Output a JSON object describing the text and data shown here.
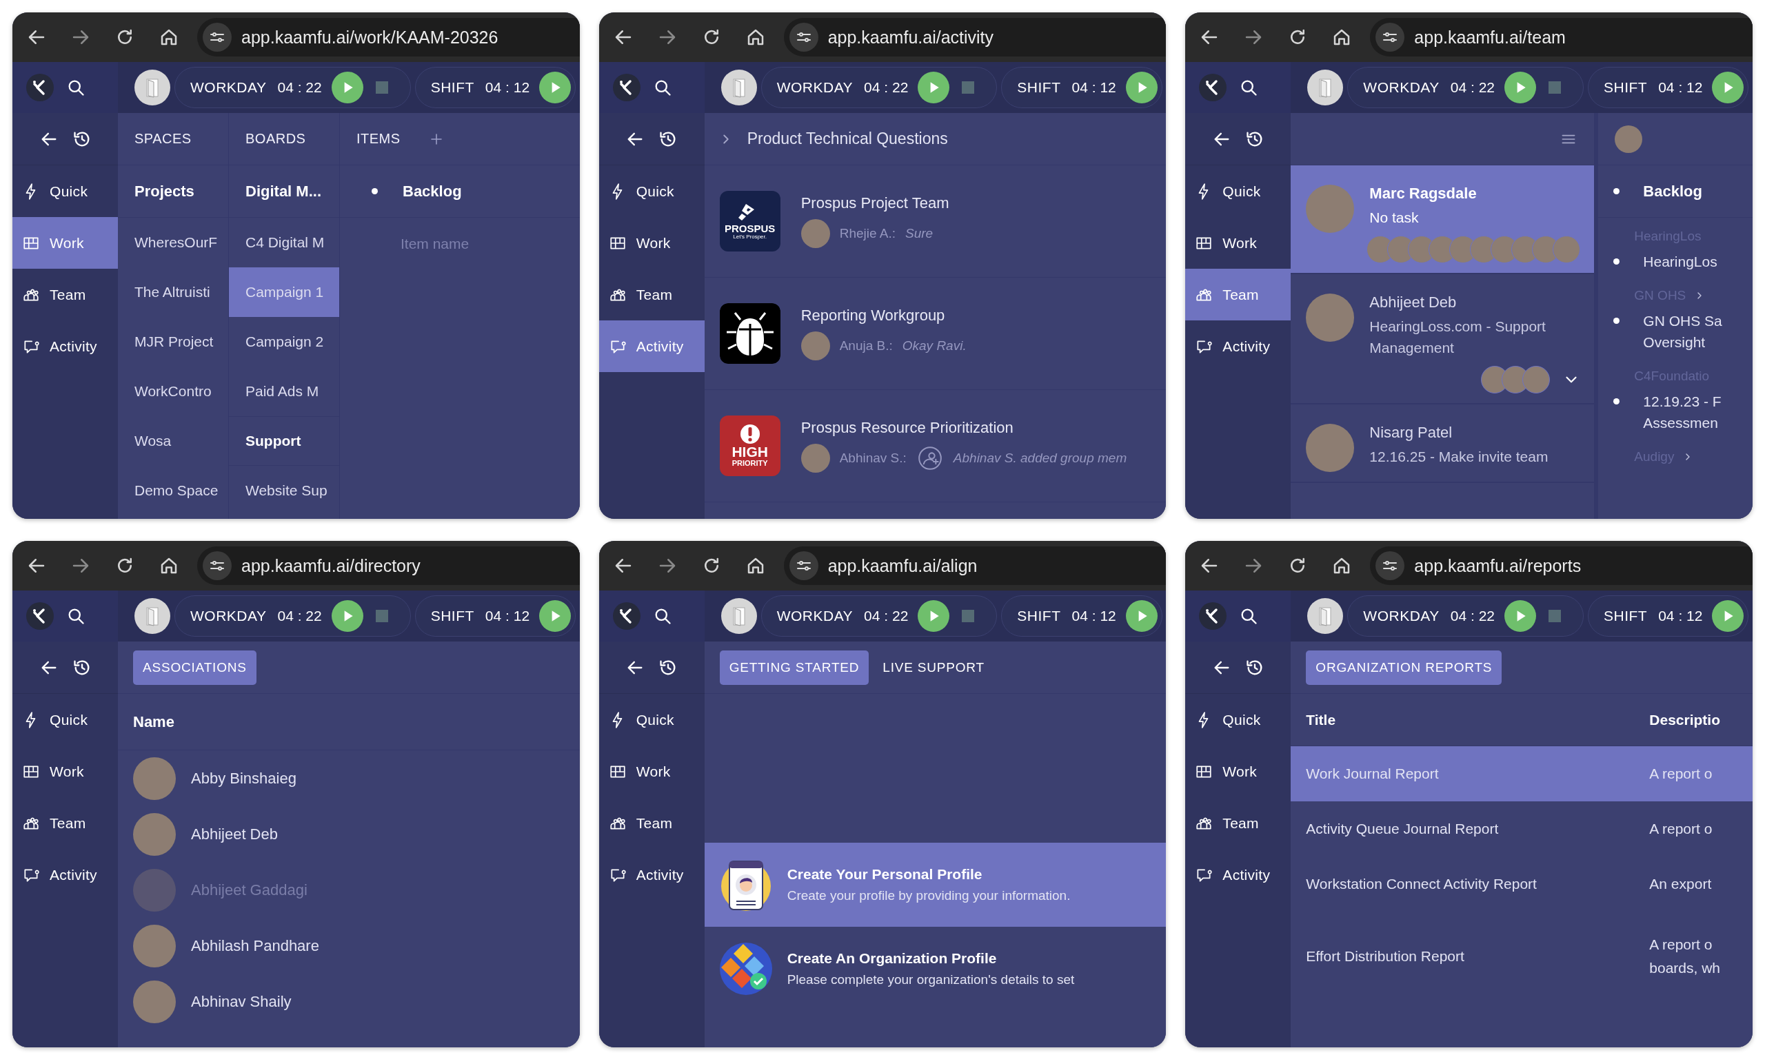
{
  "windows": [
    {
      "url": "app.kaamfu.ai/work/KAAM-20326",
      "timers": [
        {
          "label": "WORKDAY",
          "time": "04 : 22",
          "stop": true
        },
        {
          "label": "SHIFT",
          "time": "04 : 12",
          "stop": false
        }
      ],
      "nav": [
        {
          "label": "Quick",
          "selected": false
        },
        {
          "label": "Work",
          "selected": true
        },
        {
          "label": "Team",
          "selected": false
        },
        {
          "label": "Activity",
          "selected": false
        }
      ],
      "view": {
        "kind": "columns",
        "columns": [
          {
            "kind": "list",
            "header": "SPACES",
            "title": "Projects",
            "items": [
              {
                "kind": "item",
                "label": "WheresOurF",
                "selected": false
              },
              {
                "kind": "item",
                "label": "The Altruisti",
                "selected": false
              },
              {
                "kind": "item",
                "label": "MJR Project",
                "selected": false
              },
              {
                "kind": "item",
                "label": "WorkContro",
                "selected": false
              },
              {
                "kind": "item",
                "label": "Wosa",
                "selected": false
              },
              {
                "kind": "item",
                "label": "Demo Space",
                "selected": false
              }
            ]
          },
          {
            "kind": "list",
            "header": "BOARDS",
            "title": "Digital M...",
            "items": [
              {
                "kind": "item",
                "label": "C4 Digital M",
                "selected": false
              },
              {
                "kind": "item",
                "label": "Campaign 1",
                "selected": true
              },
              {
                "kind": "item",
                "label": "Campaign 2",
                "selected": false
              },
              {
                "kind": "item",
                "label": "Paid Ads M",
                "selected": false
              },
              {
                "kind": "group",
                "label": "Support"
              },
              {
                "kind": "item",
                "label": "Website Sup",
                "selected": false
              }
            ]
          },
          {
            "kind": "items",
            "header": "ITEMS",
            "title": "Backlog",
            "placeholder": "Item name"
          }
        ]
      }
    },
    {
      "url": "app.kaamfu.ai/activity",
      "timers": [
        {
          "label": "WORKDAY",
          "time": "04 : 22",
          "stop": true
        },
        {
          "label": "SHIFT",
          "time": "04 : 12",
          "stop": false
        }
      ],
      "nav": [
        {
          "label": "Quick",
          "selected": false
        },
        {
          "label": "Work",
          "selected": false
        },
        {
          "label": "Team",
          "selected": false
        },
        {
          "label": "Activity",
          "selected": true
        }
      ],
      "view": {
        "kind": "activity",
        "breadcrumb": "Product Technical Questions",
        "groups": [
          {
            "kind": "prospus",
            "logo_text": [
              "PROSPUS",
              "Let's Prosper."
            ],
            "title": "Prospus Project Team",
            "author": "Rhejie A.:",
            "message": "Sure",
            "system": false
          },
          {
            "kind": "bug",
            "title": "Reporting Workgroup",
            "author": "Anuja B.:",
            "message": "Okay Ravi.",
            "system": false
          },
          {
            "kind": "priority",
            "logo_text": [
              "HIGH",
              "PRIORITY"
            ],
            "title": "Prospus Resource Prioritization",
            "author": "Abhinav S.:",
            "message": "Abhinav S. added group mem",
            "system": true
          }
        ]
      }
    },
    {
      "url": "app.kaamfu.ai/team",
      "timers": [
        {
          "label": "WORKDAY",
          "time": "04 : 22",
          "stop": true
        },
        {
          "label": "SHIFT",
          "time": "04 : 12",
          "stop": false
        }
      ],
      "nav": [
        {
          "label": "Quick",
          "selected": false
        },
        {
          "label": "Work",
          "selected": false
        },
        {
          "label": "Team",
          "selected": true
        },
        {
          "label": "Activity",
          "selected": false
        }
      ],
      "view": {
        "kind": "team",
        "members": [
          {
            "name": "Marc Ragsdale",
            "status": "No task",
            "selected": true,
            "expandable": false,
            "photos": [
              {
                "kind": "photo"
              },
              {
                "kind": "photo"
              },
              {
                "kind": "photo"
              },
              {
                "kind": "photo"
              },
              {
                "kind": "photo"
              },
              {
                "kind": "photo"
              },
              {
                "kind": "photo"
              },
              {
                "kind": "photo"
              },
              {
                "kind": "photo"
              },
              {
                "kind": "photo"
              }
            ]
          },
          {
            "name": "Abhijeet Deb",
            "status": "HearingLoss.com - Support Management",
            "selected": false,
            "expandable": true,
            "photos": [
              {
                "kind": "photo"
              },
              {
                "kind": "photo"
              },
              {
                "kind": "photo"
              }
            ]
          },
          {
            "name": "Nisarg Patel",
            "status": "12.16.25 - Make invite team",
            "selected": false,
            "expandable": false
          }
        ],
        "side": {
          "title": "Backlog",
          "entries": [
            {
              "context": "HearingLos",
              "link": false,
              "text": "HearingLos"
            },
            {
              "context": "GN OHS",
              "link": true,
              "text": "GN OHS Sa\nOversight"
            },
            {
              "context": "C4Foundatio",
              "link": false,
              "text": "12.19.23 - F\nAssessmen"
            },
            {
              "context": "Audigy",
              "link": true
            }
          ]
        }
      }
    },
    {
      "url": "app.kaamfu.ai/directory",
      "timers": [
        {
          "label": "WORKDAY",
          "time": "04 : 22",
          "stop": true
        },
        {
          "label": "SHIFT",
          "time": "04 : 12",
          "stop": false
        }
      ],
      "nav": [
        {
          "label": "Quick",
          "selected": false
        },
        {
          "label": "Work",
          "selected": false
        },
        {
          "label": "Team",
          "selected": false
        },
        {
          "label": "Activity",
          "selected": false
        }
      ],
      "view": {
        "kind": "directory",
        "tabs": [
          {
            "label": "ASSOCIATIONS",
            "selected": true
          }
        ],
        "column": "Name",
        "rows": [
          {
            "name": "Abby Binshaieg",
            "disabled": false
          },
          {
            "name": "Abhijeet Deb",
            "disabled": false
          },
          {
            "name": "Abhijeet Gaddagi",
            "disabled": true
          },
          {
            "name": "Abhilash Pandhare",
            "disabled": false
          },
          {
            "name": "Abhinav Shaily",
            "disabled": false
          }
        ]
      }
    },
    {
      "url": "app.kaamfu.ai/align",
      "timers": [
        {
          "label": "WORKDAY",
          "time": "04 : 22",
          "stop": true
        },
        {
          "label": "SHIFT",
          "time": "04 : 12",
          "stop": false
        }
      ],
      "nav": [
        {
          "label": "Quick",
          "selected": false
        },
        {
          "label": "Work",
          "selected": false
        },
        {
          "label": "Team",
          "selected": false
        },
        {
          "label": "Activity",
          "selected": false
        }
      ],
      "view": {
        "kind": "guide",
        "tabs": [
          {
            "label": "GETTING STARTED",
            "selected": true
          },
          {
            "label": "LIVE SUPPORT",
            "selected": false
          }
        ],
        "cards": [
          {
            "kind": "profile",
            "title": "Create Your Personal Profile",
            "text": "Create your profile by providing your information.",
            "selected": true
          },
          {
            "kind": "organization",
            "title": "Create An Organization Profile",
            "text": "Please complete your organization's details to set",
            "selected": false
          }
        ]
      }
    },
    {
      "url": "app.kaamfu.ai/reports",
      "timers": [
        {
          "label": "WORKDAY",
          "time": "04 : 22",
          "stop": true
        },
        {
          "label": "SHIFT",
          "time": "04 : 12",
          "stop": false
        }
      ],
      "nav": [
        {
          "label": "Quick",
          "selected": false
        },
        {
          "label": "Work",
          "selected": false
        },
        {
          "label": "Team",
          "selected": false
        },
        {
          "label": "Activity",
          "selected": false
        }
      ],
      "view": {
        "kind": "reports",
        "tabs": [
          {
            "label": "ORGANIZATION REPORTS",
            "selected": true
          }
        ],
        "columns": [
          "Title",
          "Descriptio"
        ],
        "rows": [
          {
            "title": "Work Journal Report",
            "description": "A report o",
            "selected": true
          },
          {
            "title": "Activity Queue Journal Report",
            "description": "A report o",
            "selected": false
          },
          {
            "title": "Workstation Connect Activity Report",
            "description": "An export",
            "selected": false
          },
          {
            "title": "Effort Distribution Report",
            "description": "A report o\nboards, wh",
            "selected": false
          }
        ]
      }
    }
  ]
}
